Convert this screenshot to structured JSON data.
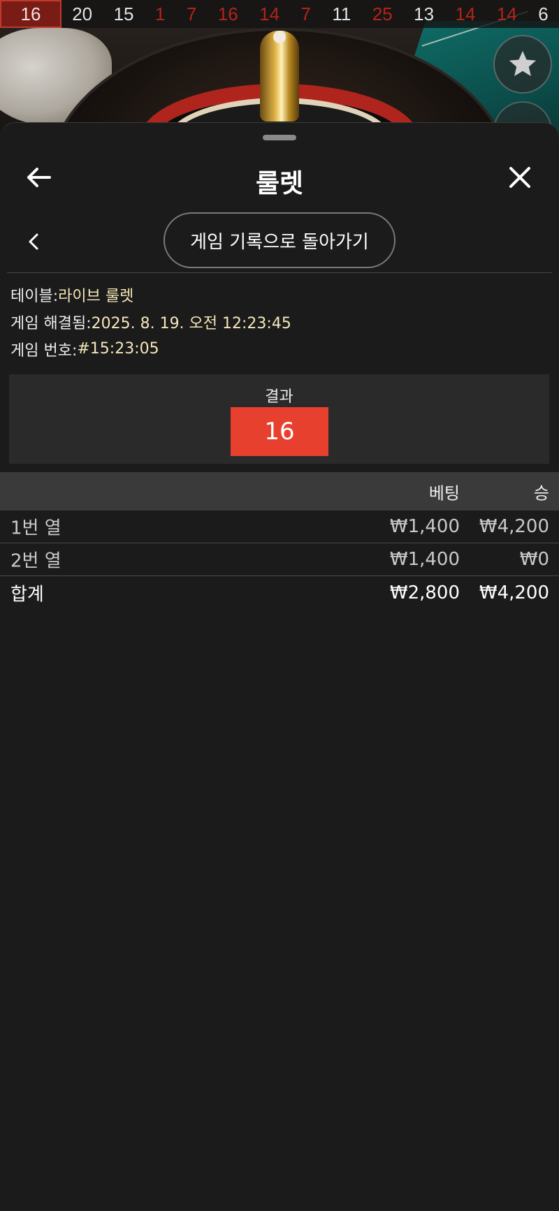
{
  "history": {
    "latest": "16",
    "numbers": [
      {
        "value": "20",
        "color": "black"
      },
      {
        "value": "15",
        "color": "black"
      },
      {
        "value": "1",
        "color": "red"
      },
      {
        "value": "7",
        "color": "red"
      },
      {
        "value": "16",
        "color": "red"
      },
      {
        "value": "14",
        "color": "red"
      },
      {
        "value": "7",
        "color": "red"
      },
      {
        "value": "11",
        "color": "black"
      },
      {
        "value": "25",
        "color": "red"
      },
      {
        "value": "13",
        "color": "black"
      },
      {
        "value": "14",
        "color": "red"
      },
      {
        "value": "14",
        "color": "red"
      },
      {
        "value": "6",
        "color": "black"
      }
    ]
  },
  "header": {
    "title": "룰렛"
  },
  "nav": {
    "history_button": "게임 기록으로 돌아가기"
  },
  "info": {
    "table_label": "테이블: ",
    "table_value": "라이브 룰렛",
    "resolved_label": "게임 해결됨: ",
    "resolved_value": "2025. 8. 19. 오전 12:23:45",
    "game_no_label": "게임 번호: ",
    "game_no_value": "#15:23:05"
  },
  "result": {
    "label": "결과",
    "number": "16",
    "color": "#e8402e"
  },
  "table": {
    "headers": {
      "bet": "베팅",
      "win": "승"
    },
    "rows": [
      {
        "name": "1번 열",
        "bet": "₩1,400",
        "win": "₩4,200"
      },
      {
        "name": "2번 열",
        "bet": "₩1,400",
        "win": "₩0"
      }
    ],
    "total": {
      "name": "합계",
      "bet": "₩2,800",
      "win": "₩4,200"
    }
  },
  "icons": {
    "back": "arrow-left-icon",
    "close": "close-icon",
    "chevron": "chevron-left-icon",
    "favorite": "star-icon"
  }
}
